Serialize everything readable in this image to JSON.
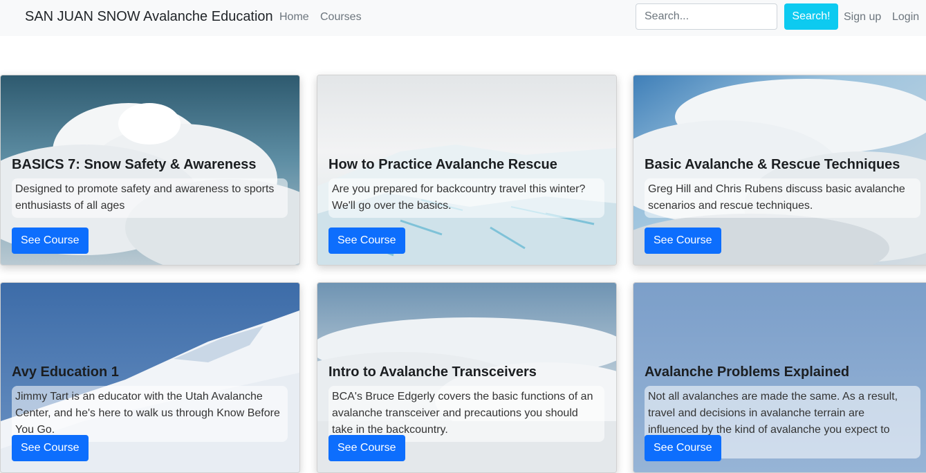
{
  "navbar": {
    "brand": "SAN JUAN SNOW Avalanche Education",
    "links": [
      "Home",
      "Courses"
    ],
    "search_placeholder": "Search...",
    "search_button": "Search!",
    "signup": "Sign up",
    "login": "Login"
  },
  "cards": [
    {
      "title": "BASICS 7: Snow Safety & Awareness",
      "text": "Designed to promote safety and awareness to sports enthusiasts of all ages",
      "button": "See Course"
    },
    {
      "title": "How to Practice Avalanche Rescue",
      "text": "Are you prepared for backcountry travel this winter? We'll go over the basics.",
      "button": "See Course"
    },
    {
      "title": "Basic Avalanche & Rescue Techniques",
      "text": "Greg Hill and Chris Rubens discuss basic avalanche scenarios and rescue techniques.",
      "button": "See Course"
    },
    {
      "title": "Avy Education 1",
      "text": "Jimmy Tart is an educator with the Utah Avalanche Center, and he's here to walk us through Know Before You Go.",
      "button": "See Course"
    },
    {
      "title": "Intro to Avalanche Transceivers",
      "text": "BCA's Bruce Edgerly covers the basic functions of an avalanche transceiver and precautions you should take in the backcountry.",
      "button": "See Course"
    },
    {
      "title": "Avalanche Problems Explained",
      "text": "Not all avalanches are made the same. As a result, travel and decisions in avalanche terrain are influenced by the kind of avalanche you expect to encounter.",
      "button": "See Course"
    }
  ]
}
